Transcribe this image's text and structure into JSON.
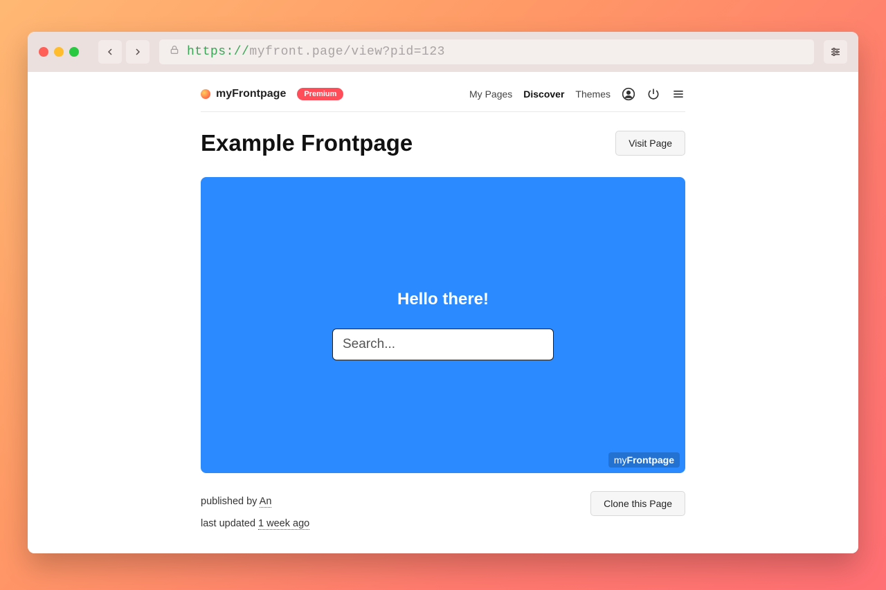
{
  "browser": {
    "url_https": "https://",
    "url_rest": "myfront.page/view?pid=123"
  },
  "logo": {
    "prefix": "my",
    "bold": "Frontpage",
    "badge": "Premium"
  },
  "nav": {
    "my_pages": "My Pages",
    "discover": "Discover",
    "themes": "Themes"
  },
  "page": {
    "title": "Example Frontpage",
    "visit_button": "Visit Page",
    "clone_button": "Clone this Page"
  },
  "preview": {
    "heading": "Hello there!",
    "search_placeholder": "Search...",
    "watermark_prefix": "my",
    "watermark_bold": "Frontpage"
  },
  "meta": {
    "published_prefix": "published by ",
    "published_by": "An",
    "updated_prefix": "last updated ",
    "updated_when": "1 week ago"
  }
}
